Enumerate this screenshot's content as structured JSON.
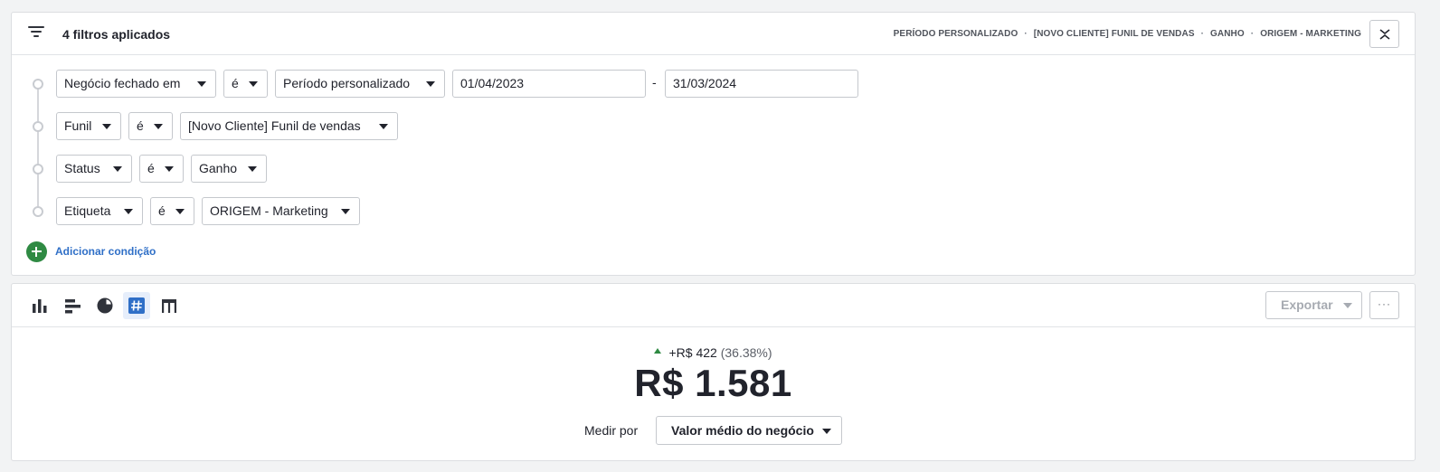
{
  "filters": {
    "count_label": "4 filtros aplicados",
    "summary": [
      "PERÍODO PERSONALIZADO",
      "[NOVO CLIENTE] FUNIL DE VENDAS",
      "GANHO",
      "ORIGEM - MARKETING"
    ],
    "summary_separator": "·",
    "conditions": [
      {
        "field": "Negócio fechado em",
        "operator": "é",
        "value": "Período personalizado",
        "date_from": "01/04/2023",
        "date_sep": "-",
        "date_to": "31/03/2024"
      },
      {
        "field": "Funil",
        "operator": "é",
        "value": "[Novo Cliente] Funil de vendas"
      },
      {
        "field": "Status",
        "operator": "é",
        "value": "Ganho"
      },
      {
        "field": "Etiqueta",
        "operator": "é",
        "value": "ORIGEM - Marketing"
      }
    ],
    "add_condition_label": "Adicionar condição"
  },
  "toolbar": {
    "viz_icons": [
      "column-chart-icon",
      "bar-chart-icon",
      "pie-chart-icon",
      "number-icon",
      "table-icon"
    ],
    "active_viz": "number-icon",
    "export_label": "Exportar",
    "more_label": "···"
  },
  "kpi": {
    "delta_value": "+R$ 422",
    "delta_percent": "(36.38%)",
    "delta_direction": "up",
    "value": "R$ 1.581",
    "measure_label": "Medir por",
    "measure_value": "Valor médio do negócio"
  },
  "colors": {
    "accent_green": "#2f8a43",
    "link_blue": "#2f6fc7",
    "active_viz_bg": "#e6eefb"
  }
}
